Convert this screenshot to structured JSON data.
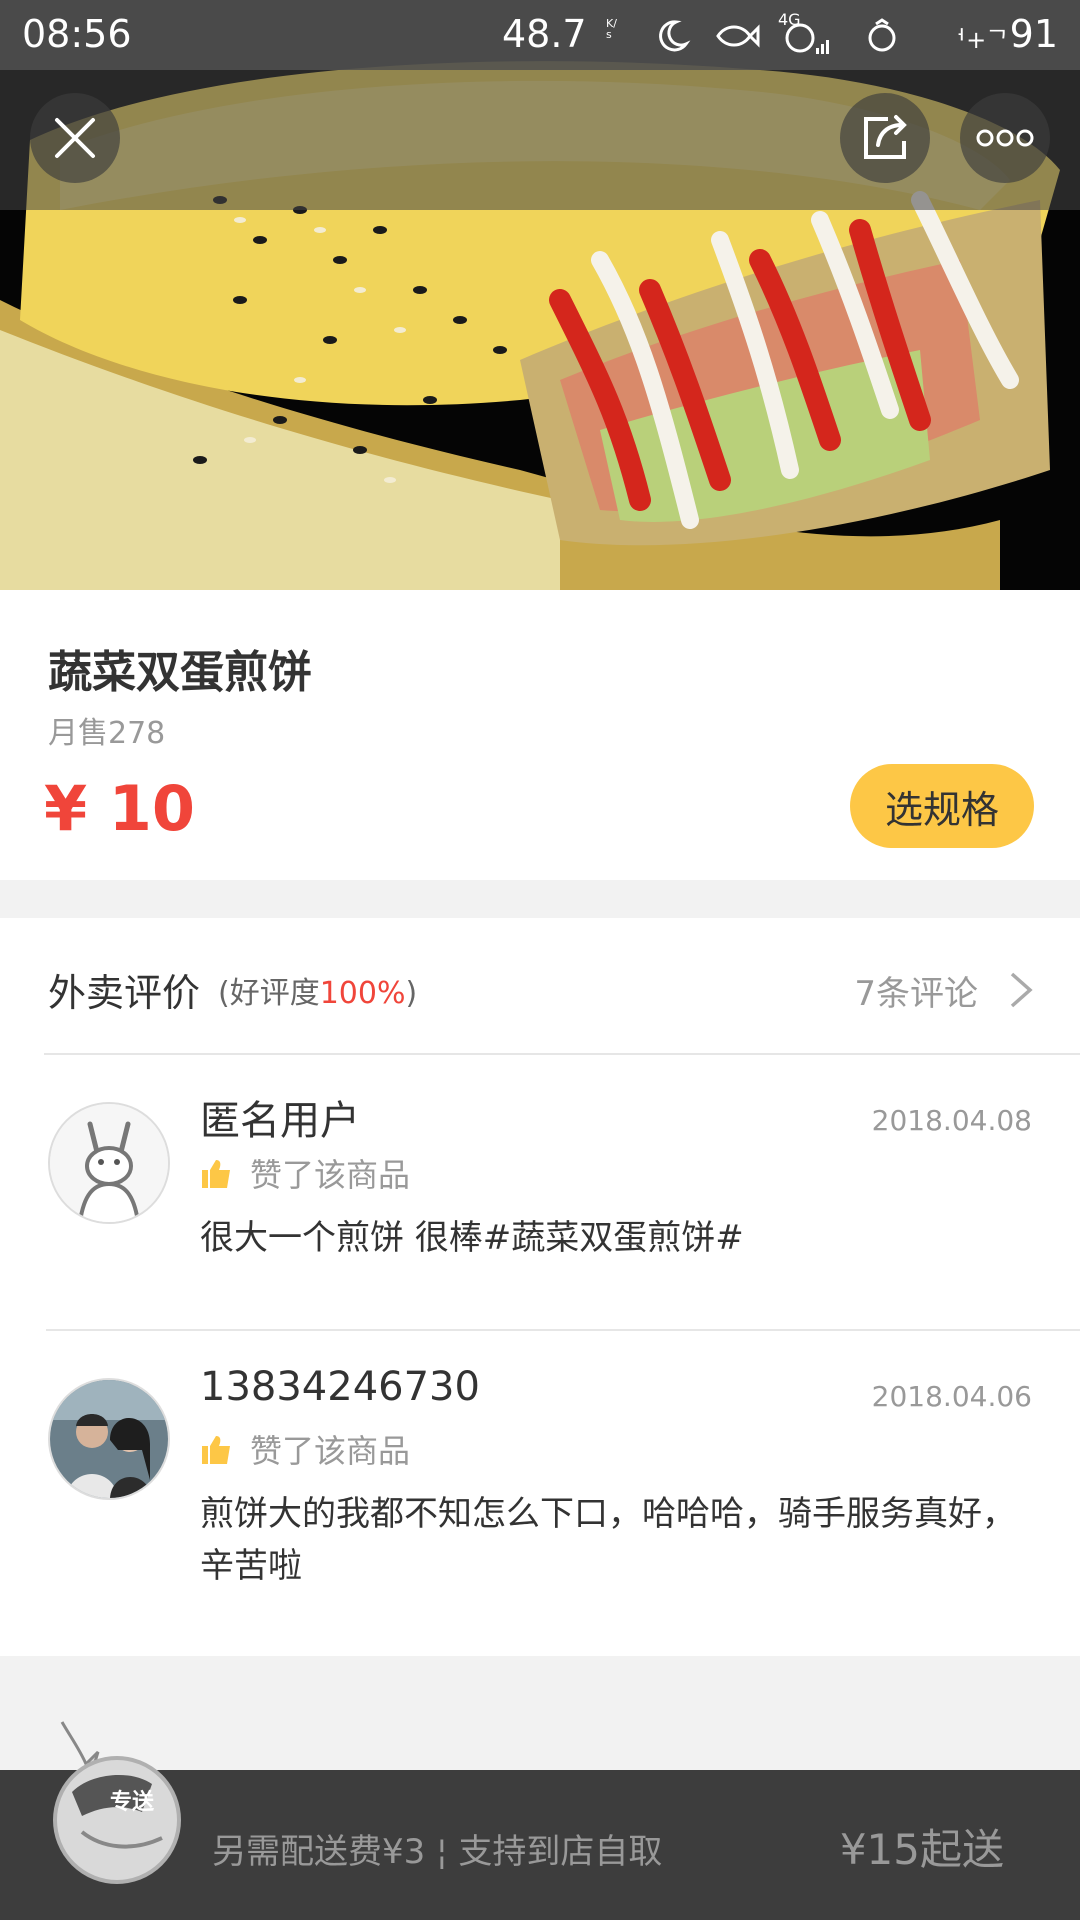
{
  "status_bar": {
    "time": "08:56",
    "speed": "48.7",
    "speed_unit": "K/s",
    "network": "4G",
    "battery": "91",
    "carrier": "ᅥ+ᄀ"
  },
  "header": {
    "close_icon": "close-icon",
    "share_icon": "share-icon",
    "more_icon": "more-icon"
  },
  "product": {
    "name": "蔬菜双蛋煎饼",
    "monthly_sales": "月售278",
    "price": "¥ 10",
    "select_spec_label": "选规格",
    "accent_color": "#f0453a",
    "button_color": "#fdc746"
  },
  "reviews": {
    "title": "外卖评价",
    "rating_prefix": "(好评度",
    "rating_value": "100%",
    "rating_suffix": ")",
    "count_label": "7条评论",
    "items": [
      {
        "user": "匿名用户",
        "date": "2018.04.08",
        "liked": "赞了该商品",
        "text": "很大一个煎饼 很棒#蔬菜双蛋煎饼#"
      },
      {
        "user": "13834246730",
        "date": "2018.04.06",
        "liked": "赞了该商品",
        "text": "煎饼大的我都不知怎么下口，哈哈哈，骑手服务真好，辛苦啦"
      }
    ]
  },
  "bottom_bar": {
    "delivery_info": "另需配送费¥3 ¦ 支持到店自取",
    "min_order": "¥15起送",
    "badge": "专送"
  }
}
